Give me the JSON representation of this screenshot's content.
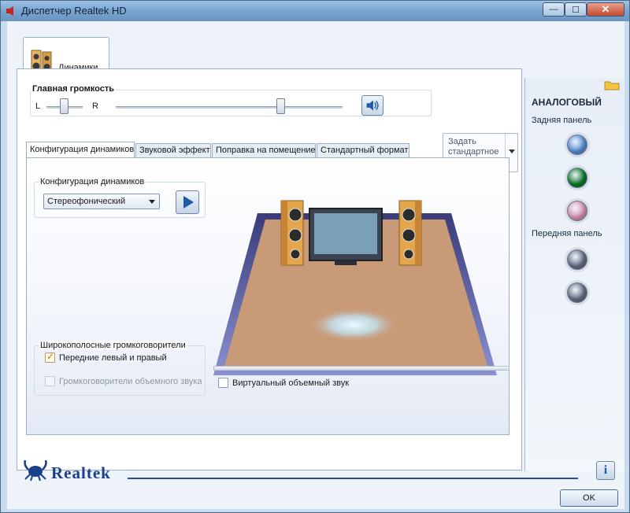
{
  "window": {
    "title": "Диспетчер Realtek HD",
    "minimize": "—",
    "maximize": "☐",
    "close": "✕"
  },
  "device_tab": {
    "label": "Динамики",
    "icon": "speaker-device-icon"
  },
  "volume": {
    "title": "Главная громкость",
    "left_label": "L",
    "right_label": "R",
    "balance": 0.5,
    "level": 0.73,
    "mute_icon": "speaker-volume-icon"
  },
  "default_device": {
    "label": "Задать стандартное устройство"
  },
  "subtabs": [
    {
      "label": "Конфигурация динамиков",
      "active": true
    },
    {
      "label": "Звуковой эффект",
      "active": false
    },
    {
      "label": "Поправка на помещение",
      "active": false
    },
    {
      "label": "Стандартный формат",
      "active": false
    }
  ],
  "speaker_config": {
    "group_title": "Конфигурация динамиков",
    "selected": "Стереофонический",
    "play_icon": "play-icon"
  },
  "fullrange": {
    "group_title": "Широкополосные громкоговорители",
    "front": {
      "label": "Передние левый и правый",
      "checked": true,
      "enabled": true
    },
    "surround": {
      "label": "Громкоговорители объемного звука",
      "checked": false,
      "enabled": false
    }
  },
  "virtual_surround": {
    "label": "Виртуальный объемный звук",
    "checked": false
  },
  "analog": {
    "title": "АНАЛОГОВЫЙ",
    "rear_label": "Задняя панель",
    "front_label": "Передняя панель",
    "rear_jacks": [
      {
        "name": "rear-jack-blue",
        "color": "#5a8fd8"
      },
      {
        "name": "rear-jack-green",
        "color": "#0e7a2c"
      },
      {
        "name": "rear-jack-pink",
        "color": "#d892b4"
      }
    ],
    "front_jacks": [
      {
        "name": "front-jack-1",
        "color": "#6a6e86"
      },
      {
        "name": "front-jack-2",
        "color": "#6a6e86"
      }
    ]
  },
  "brand": {
    "name": "Realtek"
  },
  "buttons": {
    "info": "i",
    "ok": "OK"
  },
  "colors": {
    "accent": "#1f5aa8",
    "floor": "#c89a78",
    "title_bar": "#7ca6d0"
  }
}
